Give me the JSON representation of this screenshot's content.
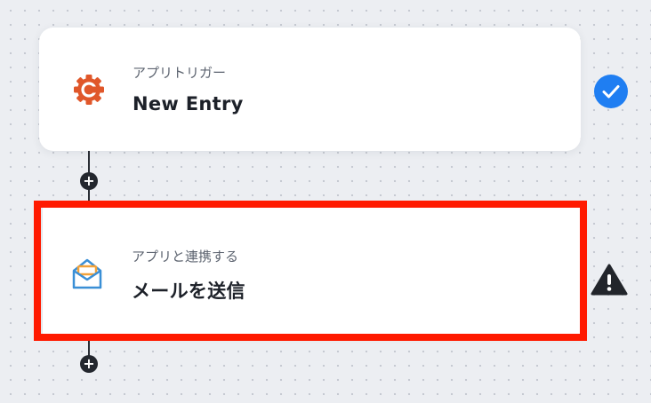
{
  "trigger": {
    "label": "アプリトリガー",
    "title": "New Entry",
    "icon": "cognito-forms-icon",
    "status": "complete"
  },
  "action": {
    "label": "アプリと連携する",
    "title": "メールを送信",
    "icon": "mail-icon",
    "status": "warning"
  },
  "add_symbol": "+",
  "colors": {
    "highlight": "#ff1a00",
    "check": "#1f7ef2",
    "trigger_icon": "#e0572a",
    "mail_icon": "#3a8fd6",
    "mail_accent": "#f2a23a"
  }
}
